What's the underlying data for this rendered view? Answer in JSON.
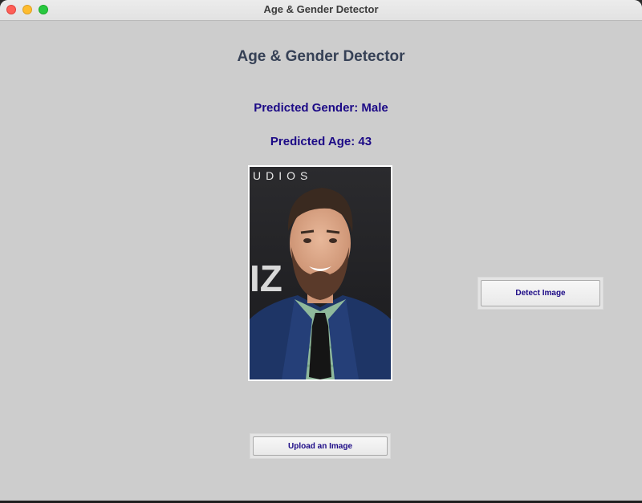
{
  "window": {
    "title": "Age & Gender Detector"
  },
  "main": {
    "heading": "Age & Gender Detector",
    "gender_label": "Predicted Gender: Male",
    "age_label": "Predicted Age: 43",
    "photo_backdrop_text": {
      "top": "UDIOS",
      "middle": "IZ"
    }
  },
  "buttons": {
    "detect_label": "Detect Image",
    "upload_label": "Upload an Image"
  },
  "colors": {
    "window_bg": "#cdcdcd",
    "heading": "#364156",
    "result_text": "#1c0a86",
    "button_text": "#1c0a86"
  },
  "icons": {
    "close": "red-dot",
    "minimize": "yellow-dot",
    "maximize": "green-dot"
  }
}
